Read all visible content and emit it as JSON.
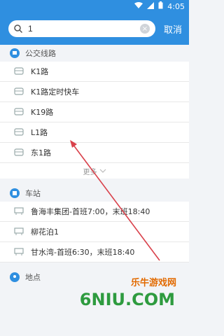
{
  "status": {
    "time": "4:05"
  },
  "search": {
    "value": "1",
    "cancel_label": "取消",
    "clear_symbol": "×"
  },
  "sections": {
    "bus_lines": {
      "title": "公交线路",
      "items": [
        "K1路",
        "K1路定时快车",
        "K19路",
        "L1路",
        "东1路"
      ],
      "more_label": "更多"
    },
    "stations": {
      "title": "车站",
      "items": [
        "鲁海丰集团-首班7:00，末班18:40",
        "柳花泊1",
        "甘水湾-首班6:30，末班18:40"
      ]
    },
    "places": {
      "title": "地点"
    }
  },
  "watermark": {
    "text": "乐牛游戏网",
    "domain": "6NIU.COM"
  },
  "colors": {
    "accent": "#2f8fe0",
    "annotation_arrow": "#d9414b"
  }
}
